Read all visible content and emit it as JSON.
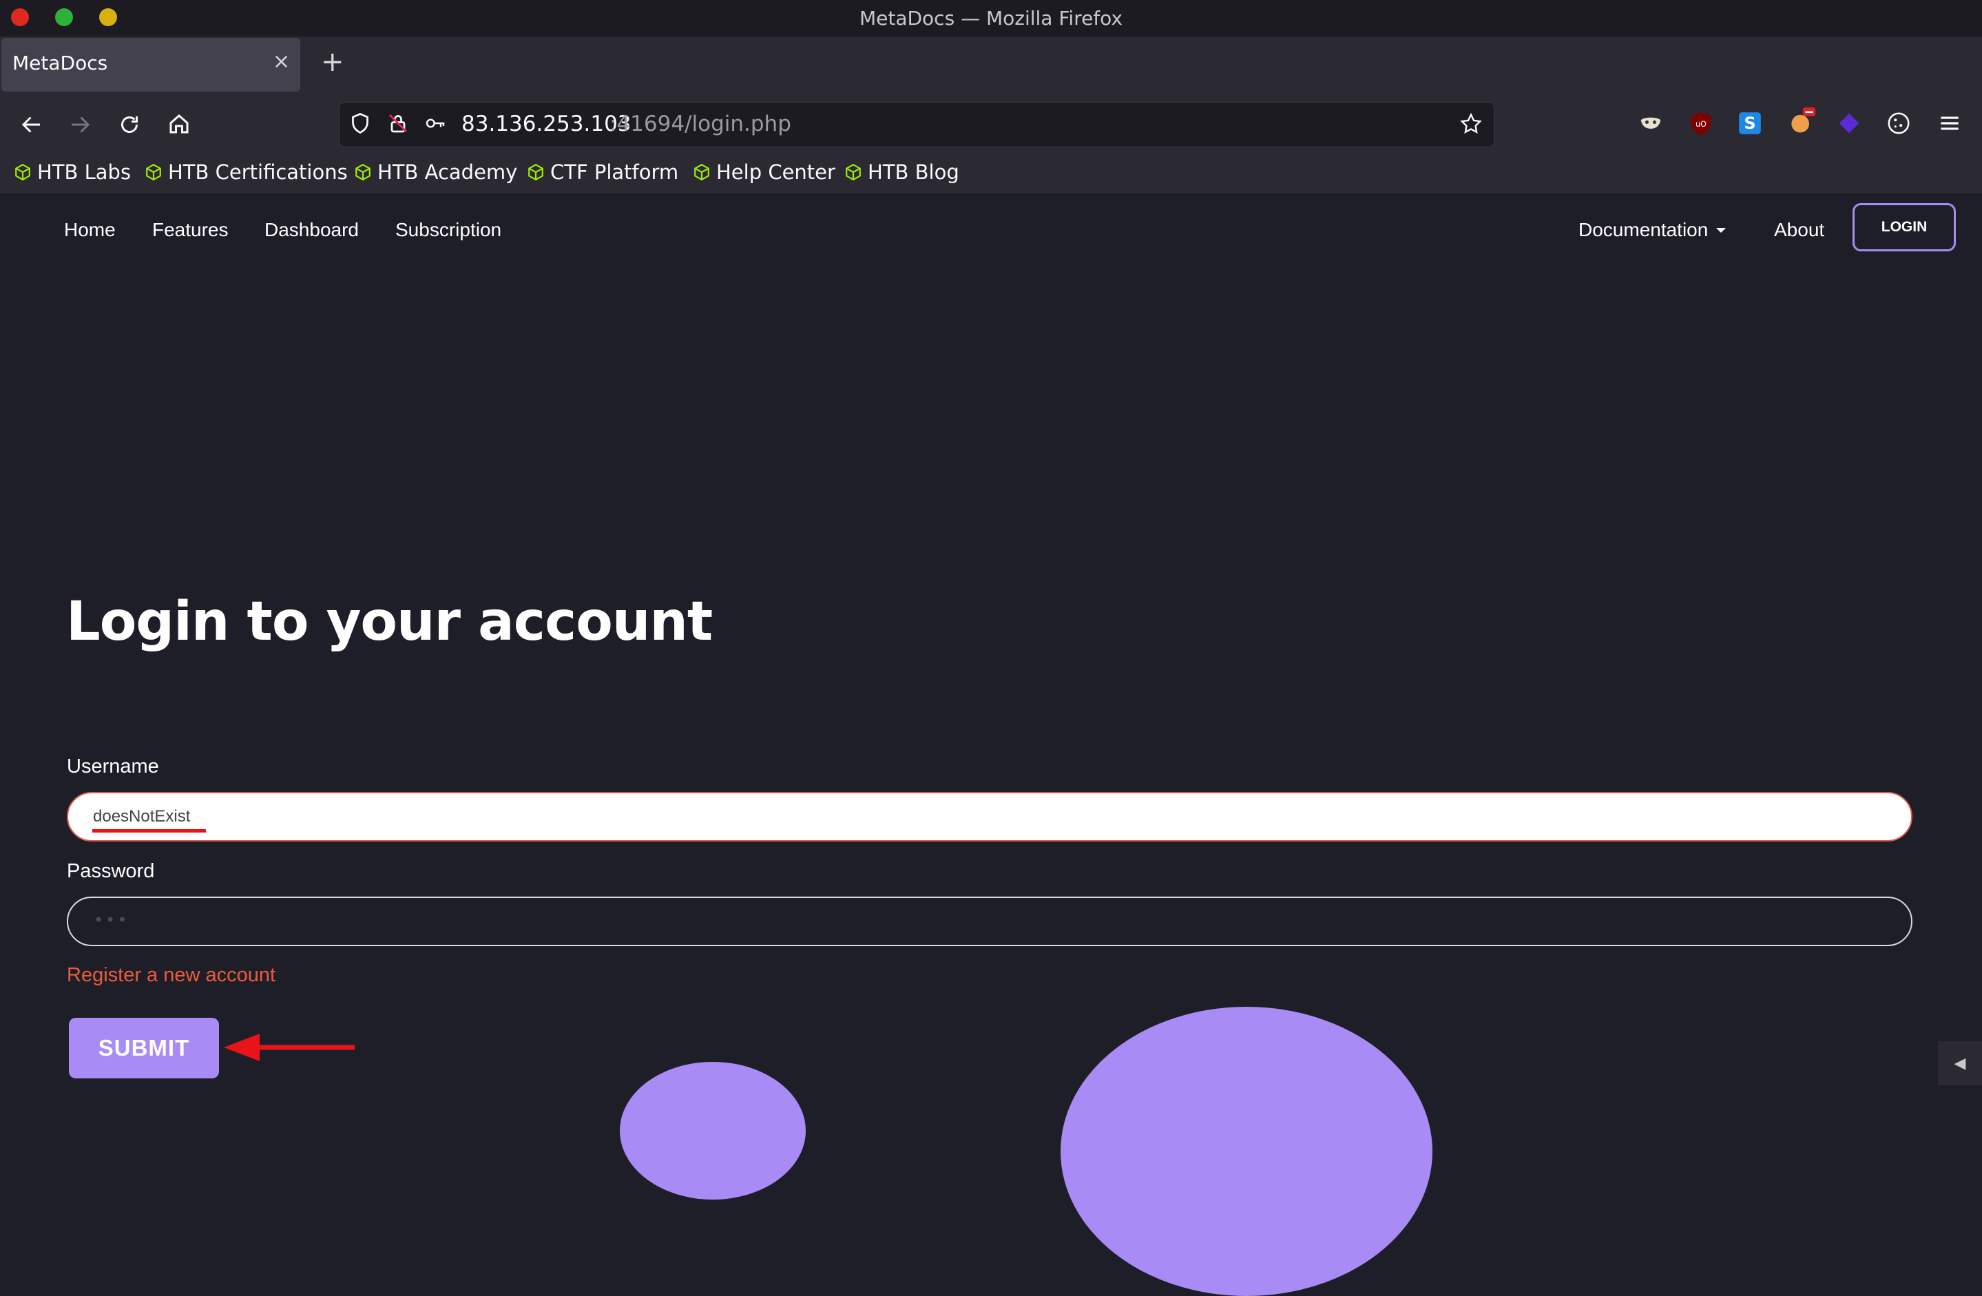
{
  "window": {
    "title": "MetaDocs — Mozilla Firefox"
  },
  "tab": {
    "title": "MetaDocs",
    "close": "×",
    "new_tab": "+"
  },
  "address": {
    "host": "83.136.253.103",
    "path": ":41694/login.php"
  },
  "bookmarks": [
    "HTB Labs",
    "HTB Certifications",
    "HTB Academy",
    "CTF Platform",
    "Help Center",
    "HTB Blog"
  ],
  "site_nav": {
    "left": [
      "Home",
      "Features",
      "Dashboard",
      "Subscription"
    ],
    "documentation": "Documentation",
    "about": "About",
    "login": "LOGIN"
  },
  "form": {
    "heading": "Login to your account",
    "username_label": "Username",
    "username_value": "doesNotExist",
    "password_label": "Password",
    "password_value": "•••",
    "register_link": "Register a new account",
    "submit": "SUBMIT"
  },
  "colors": {
    "accent": "#a88bf4",
    "link": "#ee5a3c",
    "annotation": "#e8141a",
    "bookmark_icon": "#9fef00"
  }
}
